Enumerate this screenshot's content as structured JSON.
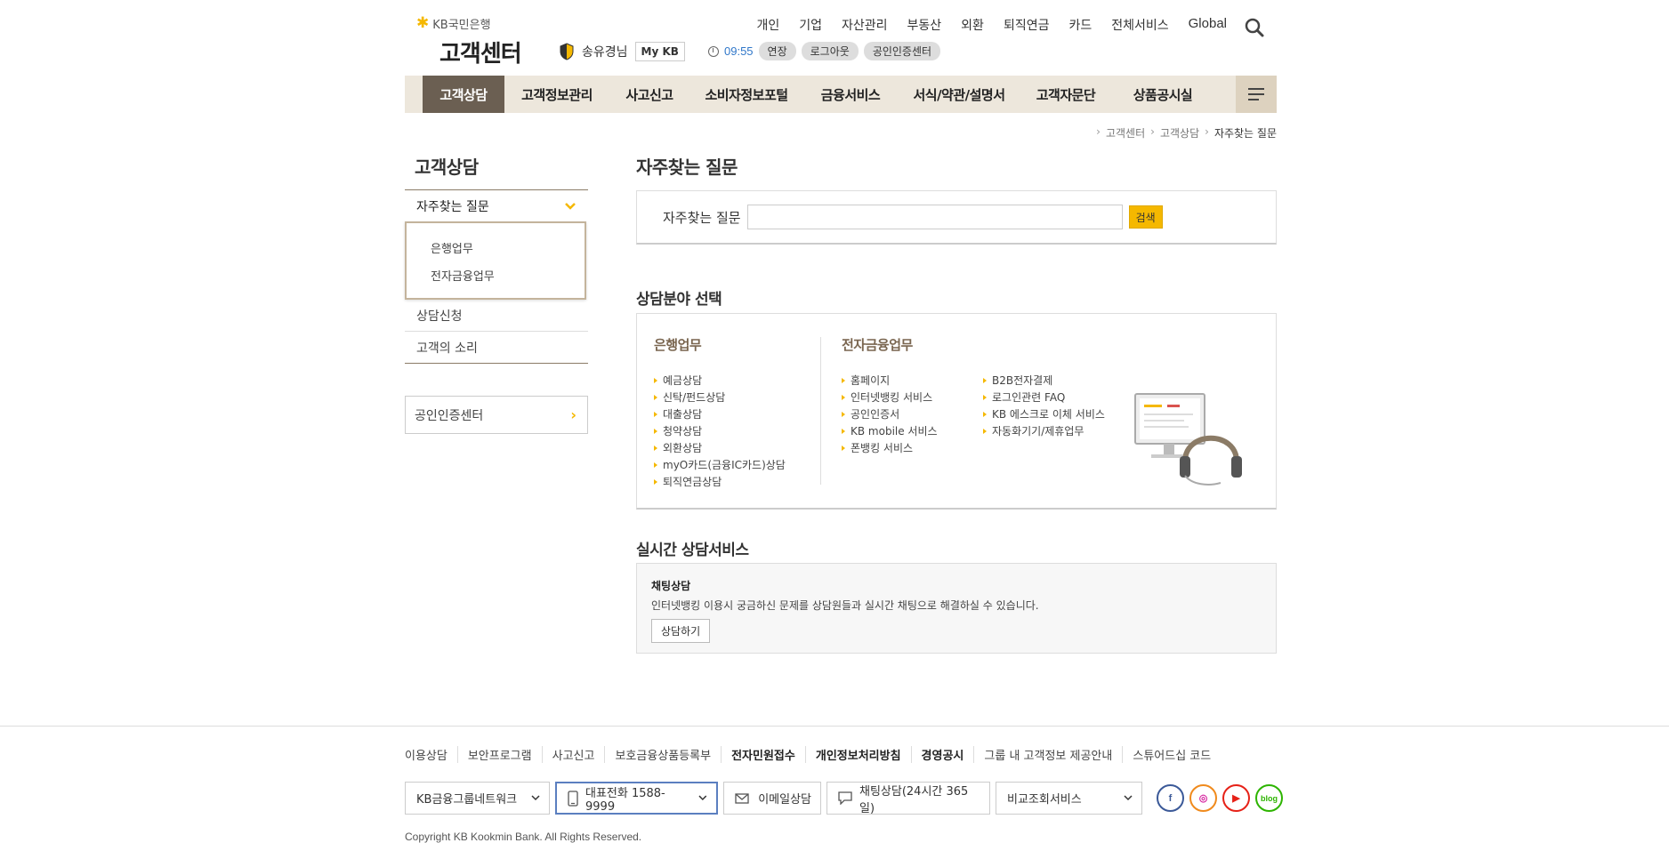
{
  "header": {
    "brand": "KB국민은행",
    "site_title": "고객센터",
    "user_name": "송유경님",
    "mykb": "My KB",
    "session_time": "09:55",
    "extend": "연장",
    "logout": "로그아웃",
    "cert_center": "공인인증센터",
    "top_nav": [
      "개인",
      "기업",
      "자산관리",
      "부동산",
      "외환",
      "퇴직연금",
      "카드",
      "전체서비스",
      "Global"
    ]
  },
  "gnb": [
    "고객상담",
    "고객정보관리",
    "사고신고",
    "소비자정보포털",
    "금융서비스",
    "서식/약관/설명서",
    "고객자문단",
    "상품공시실"
  ],
  "breadcrumb": [
    "고객센터",
    "고객상담",
    "자주찾는 질문"
  ],
  "lnb": {
    "title": "고객상담",
    "current": "자주찾는 질문",
    "sub_items": [
      "은행업무",
      "전자금융업무"
    ],
    "items": [
      "상담신청",
      "고객의 소리"
    ],
    "cert_box": "공인인증센터"
  },
  "main": {
    "title": "자주찾는 질문",
    "search_label": "자주찾는 질문",
    "search_value": "",
    "search_button": "검색",
    "area_title": "상담분야 선택",
    "bank_title": "은행업무",
    "bank_items": [
      "예금상담",
      "신탁/펀드상담",
      "대출상담",
      "청약상담",
      "외환상담",
      "myO카드(금융IC카드)상담",
      "퇴직연금상담"
    ],
    "ebank_title": "전자금융업무",
    "ebank_items_a": [
      "홈페이지",
      "인터넷뱅킹 서비스",
      "공인인증서",
      "KB mobile 서비스",
      "폰뱅킹 서비스"
    ],
    "ebank_items_b": [
      "B2B전자결제",
      "로그인관련 FAQ",
      "KB 에스크로 이체 서비스",
      "자동화기기/제휴업무"
    ],
    "realtime_title": "실시간 상담서비스",
    "chat_title": "채팅상담",
    "chat_desc": "인터넷뱅킹 이용시 궁금하신 문제를 상담원들과 실시간 채팅으로 해결하실 수 있습니다.",
    "chat_button": "상담하기"
  },
  "footer": {
    "links": [
      "이용상담",
      "보안프로그램",
      "사고신고",
      "보호금융상품등록부",
      "전자민원접수",
      "개인정보처리방침",
      "경영공시",
      "그룹 내 고객정보 제공안내",
      "스튜어드십 코드"
    ],
    "network": "KB금융그룹네트워크",
    "phone": "대표전화 1588-9999",
    "email": "이메일상담",
    "chat": "채팅상담(24시간 365일)",
    "compare": "비교조회서비스",
    "sns_blog": "blog",
    "copyright": "Copyright KB Kookmin Bank. All Rights Reserved."
  },
  "colors": {
    "accent": "#f5b800",
    "brand_brown": "#6b5f52",
    "gnb_bg": "#ede7dc"
  }
}
